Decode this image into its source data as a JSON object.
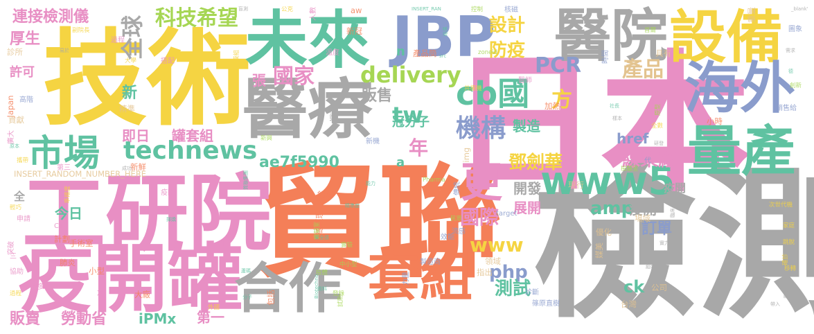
{
  "palette": {
    "gray": "#a8a8a8",
    "yellow": "#f5d442",
    "pink": "#e88fc4",
    "orange": "#f47f58",
    "teal": "#5fc2a1",
    "green": "#a6d654",
    "blue": "#8a9ccc",
    "tan": "#e3c38f"
  },
  "words": [
    {
      "text": "檢測",
      "color": "gray",
      "weight": 1.0
    },
    {
      "text": "貿聯",
      "color": "orange",
      "weight": 0.98
    },
    {
      "text": "日本",
      "color": "pink",
      "weight": 0.95
    },
    {
      "text": "技術",
      "color": "yellow",
      "weight": 0.9
    },
    {
      "text": "工研院",
      "color": "pink",
      "weight": 0.82
    },
    {
      "text": "疫開罐",
      "color": "pink",
      "weight": 0.8
    },
    {
      "text": "醫療",
      "color": "gray",
      "weight": 0.8
    },
    {
      "text": "未來",
      "color": "teal",
      "weight": 0.7
    },
    {
      "text": "JBP",
      "color": "blue",
      "weight": 0.65
    },
    {
      "text": "醫院",
      "color": "gray",
      "weight": 0.6
    },
    {
      "text": "設備",
      "color": "yellow",
      "weight": 0.6
    },
    {
      "text": "海外",
      "color": "blue",
      "weight": 0.58
    },
    {
      "text": "量產",
      "color": "teal",
      "weight": 0.56
    },
    {
      "text": "合作",
      "color": "gray",
      "weight": 0.55
    },
    {
      "text": "套組",
      "color": "orange",
      "weight": 0.55
    },
    {
      "text": "市場",
      "color": "teal",
      "weight": 0.45
    },
    {
      "text": "www5",
      "color": "teal",
      "weight": 0.45
    },
    {
      "text": "更",
      "color": "pink",
      "weight": 0.45
    },
    {
      "text": "technews",
      "color": "teal",
      "weight": 0.4
    },
    {
      "text": "cb國",
      "color": "teal",
      "weight": 0.38
    },
    {
      "text": "全球",
      "color": "gray",
      "weight": 0.35
    },
    {
      "text": "科技希望",
      "color": "green",
      "weight": 0.32
    },
    {
      "text": "連接檢測儀",
      "color": "pink",
      "weight": 0.25
    },
    {
      "text": "delivery",
      "color": "green",
      "weight": 0.3
    },
    {
      "text": "PCR",
      "color": "blue",
      "weight": 0.3
    },
    {
      "text": "產品",
      "color": "tan",
      "weight": 0.3
    },
    {
      "text": "機構",
      "color": "blue",
      "weight": 0.3
    },
    {
      "text": "國家",
      "color": "pink",
      "weight": 0.28
    },
    {
      "text": "設計",
      "color": "yellow",
      "weight": 0.25
    },
    {
      "text": "防疫",
      "color": "yellow",
      "weight": 0.25
    },
    {
      "text": "tw",
      "color": "teal",
      "weight": 0.28
    },
    {
      "text": "方",
      "color": "yellow",
      "weight": 0.26
    },
    {
      "text": "年",
      "color": "pink",
      "weight": 0.25
    },
    {
      "text": "鄧劍華",
      "color": "yellow",
      "weight": 0.25
    },
    {
      "text": "線束廠",
      "color": "pink",
      "weight": 0.25
    },
    {
      "text": "ae7f5990",
      "color": "teal",
      "weight": 0.25
    },
    {
      "text": "國際",
      "color": "pink",
      "weight": 0.28
    },
    {
      "text": "amp",
      "color": "teal",
      "weight": 0.25
    },
    {
      "text": "疫開",
      "color": "gray",
      "weight": 0.2
    },
    {
      "text": "訂單",
      "color": "blue",
      "weight": 0.22
    },
    {
      "text": "www",
      "color": "yellow",
      "weight": 0.26
    },
    {
      "text": "php",
      "color": "blue",
      "weight": 0.24
    },
    {
      "text": "測試",
      "color": "teal",
      "weight": 0.25
    },
    {
      "text": "ck",
      "color": "teal",
      "weight": 0.22
    },
    {
      "text": "開發",
      "color": "gray",
      "weight": 0.2
    },
    {
      "text": "展開",
      "color": "pink",
      "weight": 0.2
    },
    {
      "text": "今日",
      "color": "teal",
      "weight": 0.2
    },
    {
      "text": "iPMx",
      "color": "teal",
      "weight": 0.22
    },
    {
      "text": "第一",
      "color": "pink",
      "weight": 0.2
    },
    {
      "text": "勞動省",
      "color": "pink",
      "weight": 0.2
    },
    {
      "text": "販賣",
      "color": "pink",
      "weight": 0.2
    },
    {
      "text": "即日",
      "color": "pink",
      "weight": 0.2
    },
    {
      "text": "罐套組",
      "color": "pink",
      "weight": 0.2
    },
    {
      "text": "厚生",
      "color": "pink",
      "weight": 0.2
    },
    {
      "text": "許可",
      "color": "pink",
      "weight": 0.18
    },
    {
      "text": "新",
      "color": "teal",
      "weight": 0.18
    },
    {
      "text": "張",
      "color": "pink",
      "weight": 0.18
    },
    {
      "text": "販售",
      "color": "gray",
      "weight": 0.18
    },
    {
      "text": "製造",
      "color": "teal",
      "weight": 0.18
    },
    {
      "text": "href",
      "color": "blue",
      "weight": 0.18
    },
    {
      "text": "冠分子",
      "color": "teal",
      "weight": 0.15
    },
    {
      "text": "疫開",
      "color": "gray",
      "weight": 0.15
    },
    {
      "text": "全",
      "color": "gray",
      "weight": 0.15
    },
    {
      "text": "a",
      "color": "teal",
      "weight": 0.15
    },
    {
      "text": "n",
      "color": "teal",
      "weight": 0.15
    }
  ],
  "small_words": [
    "盲測",
    "公克",
    "人數",
    "aw",
    "INSERT_RAN",
    "控制",
    "核磁",
    "重量",
    "_blank'",
    "副院長",
    "過程",
    "新冠",
    "結果",
    "首爾",
    "圖象",
    "診所",
    "易於",
    "模組",
    "溫度",
    "產品簡",
    "src",
    "zoneid",
    "時間",
    "具有",
    "需求",
    "大學",
    "搭配",
    "Japan",
    "德",
    "創新",
    "高階",
    "精準",
    "MRI",
    "共振機",
    "醫師",
    "加熱",
    "社長",
    "原型",
    "銷售給",
    "貢獻",
    "樣本",
    "全數",
    "廣大",
    "小時",
    "原本",
    "新興",
    "新機",
    "img",
    "研發",
    "攜帶",
    "第三",
    "新鮮",
    "質聯集團",
    "檢驗室",
    "代",
    "INSERT_RANDOM_NUMBER_HERE",
    "成功",
    "準確度",
    "疫開",
    "鉛焊",
    "能力",
    "Pharma",
    "傳統",
    "現行",
    "急診室",
    "輕巧",
    "CT",
    "總經理",
    "精準度",
    "民眾",
    "target",
    "場域",
    "臨床",
    "次世代機",
    "申請",
    "計劃",
    "揮嬌",
    "實驗室",
    "流感",
    "優化",
    "人次",
    "家庭",
    "突破",
    "手術室",
    "安全感",
    "實驗",
    "效能",
    "媒美",
    "實力",
    "跳脫",
    "三",
    "肺炎",
    "Biotechno",
    "中小型",
    "製造商",
    "領域",
    "正確",
    "確診",
    "協助",
    "小型",
    "蘆碼",
    "檢體",
    "力量",
    "指出",
    "組裝",
    "移轉",
    "更多",
    "包括",
    "資料",
    "登錄",
    "診斷",
    "公司",
    "原型機",
    "過程",
    "次",
    "大廠",
    "分子",
    "試劑",
    "篠原直樹",
    "台灣",
    "帶入",
    "外國"
  ]
}
